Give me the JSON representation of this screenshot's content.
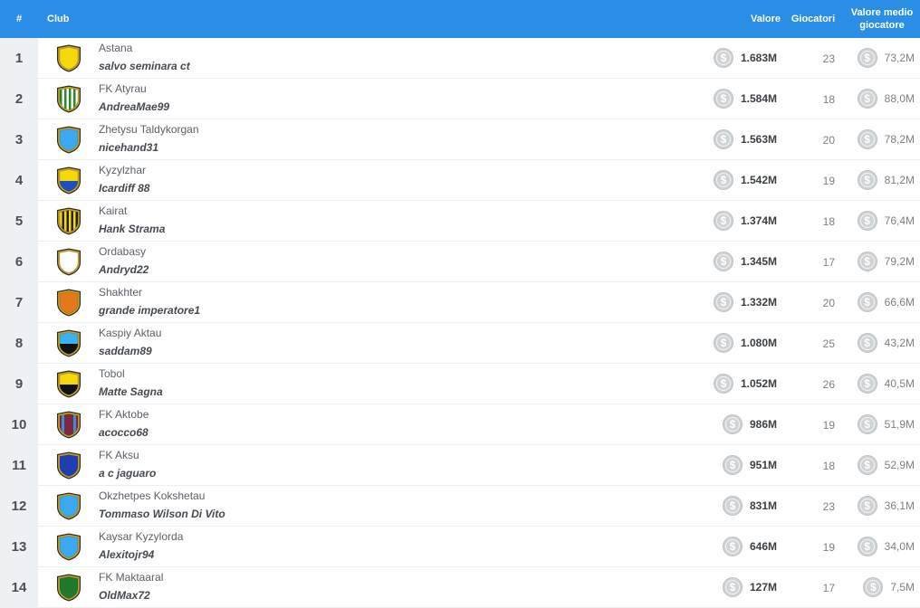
{
  "header": {
    "rank": "#",
    "club": "Club",
    "valore": "Valore",
    "giocatori": "Giocatori",
    "valore_medio_line1": "Valore medio",
    "valore_medio_line2": "giocatore"
  },
  "coin_symbol": "$",
  "colors": {
    "header_bg": "#2a8ee6",
    "rank_bg": "#eef1f3",
    "coin": "#cfd3d6"
  },
  "rows": [
    {
      "rank": "1",
      "club": "Astana",
      "owner": "salvo seminara ct",
      "valore": "1.683M",
      "giocatori": "23",
      "valore_medio": "73,2M",
      "shield": {
        "type": "solid",
        "c1": "#f5d90a"
      }
    },
    {
      "rank": "2",
      "club": "FK Atyrau",
      "owner": "AndreaMae99",
      "valore": "1.584M",
      "giocatori": "18",
      "valore_medio": "88,0M",
      "shield": {
        "type": "vstripes",
        "c1": "#2a8a2a",
        "c2": "#ffffff"
      }
    },
    {
      "rank": "3",
      "club": "Zhetysu Taldykorgan",
      "owner": "nicehand31",
      "valore": "1.563M",
      "giocatori": "20",
      "valore_medio": "78,2M",
      "shield": {
        "type": "solid",
        "c1": "#3ba9f0"
      }
    },
    {
      "rank": "4",
      "club": "Kyzylzhar",
      "owner": "Icardiff 88",
      "valore": "1.542M",
      "giocatori": "19",
      "valore_medio": "81,2M",
      "shield": {
        "type": "hsplit",
        "c1": "#f5d90a",
        "c2": "#1f4fbf"
      }
    },
    {
      "rank": "5",
      "club": "Kairat",
      "owner": "Hank Strama",
      "valore": "1.374M",
      "giocatori": "18",
      "valore_medio": "76,4M",
      "shield": {
        "type": "vstripes",
        "c1": "#f5d90a",
        "c2": "#222222"
      }
    },
    {
      "rank": "6",
      "club": "Ordabasy",
      "owner": "Andryd22",
      "valore": "1.345M",
      "giocatori": "17",
      "valore_medio": "79,2M",
      "shield": {
        "type": "solid",
        "c1": "#ffffff"
      }
    },
    {
      "rank": "7",
      "club": "Shakhter",
      "owner": "grande imperatore1",
      "valore": "1.332M",
      "giocatori": "20",
      "valore_medio": "66,6M",
      "shield": {
        "type": "solid",
        "c1": "#e07a1c"
      }
    },
    {
      "rank": "8",
      "club": "Kaspiy Aktau",
      "owner": "saddam89",
      "valore": "1.080M",
      "giocatori": "25",
      "valore_medio": "43,2M",
      "shield": {
        "type": "hsplit",
        "c1": "#37b3ee",
        "c2": "#111111"
      }
    },
    {
      "rank": "9",
      "club": "Tobol",
      "owner": "Matte Sagna",
      "valore": "1.052M",
      "giocatori": "26",
      "valore_medio": "40,5M",
      "shield": {
        "type": "hsplit",
        "c1": "#f5d90a",
        "c2": "#111111"
      }
    },
    {
      "rank": "10",
      "club": "FK Aktobe",
      "owner": "acocco68",
      "valore": "986M",
      "giocatori": "19",
      "valore_medio": "51,9M",
      "shield": {
        "type": "vsplit",
        "c1": "#7e2840",
        "c2": "#3a8fd6"
      }
    },
    {
      "rank": "11",
      "club": "FK Aksu",
      "owner": "a c jaguaro",
      "valore": "951M",
      "giocatori": "18",
      "valore_medio": "52,9M",
      "shield": {
        "type": "solid",
        "c1": "#1f3fb0"
      }
    },
    {
      "rank": "12",
      "club": "Okzhetpes Kokshetau",
      "owner": "Tommaso Wilson Di Vito",
      "valore": "831M",
      "giocatori": "23",
      "valore_medio": "36,1M",
      "shield": {
        "type": "solid",
        "c1": "#3ba9f0"
      }
    },
    {
      "rank": "13",
      "club": "Kaysar Kyzylorda",
      "owner": "Alexitojr94",
      "valore": "646M",
      "giocatori": "19",
      "valore_medio": "34,0M",
      "shield": {
        "type": "solid",
        "c1": "#3ba9f0"
      }
    },
    {
      "rank": "14",
      "club": "FK Maktaaral",
      "owner": "OldMax72",
      "valore": "127M",
      "giocatori": "17",
      "valore_medio": "7,5M",
      "shield": {
        "type": "solid",
        "c1": "#1f7a2f"
      }
    }
  ]
}
